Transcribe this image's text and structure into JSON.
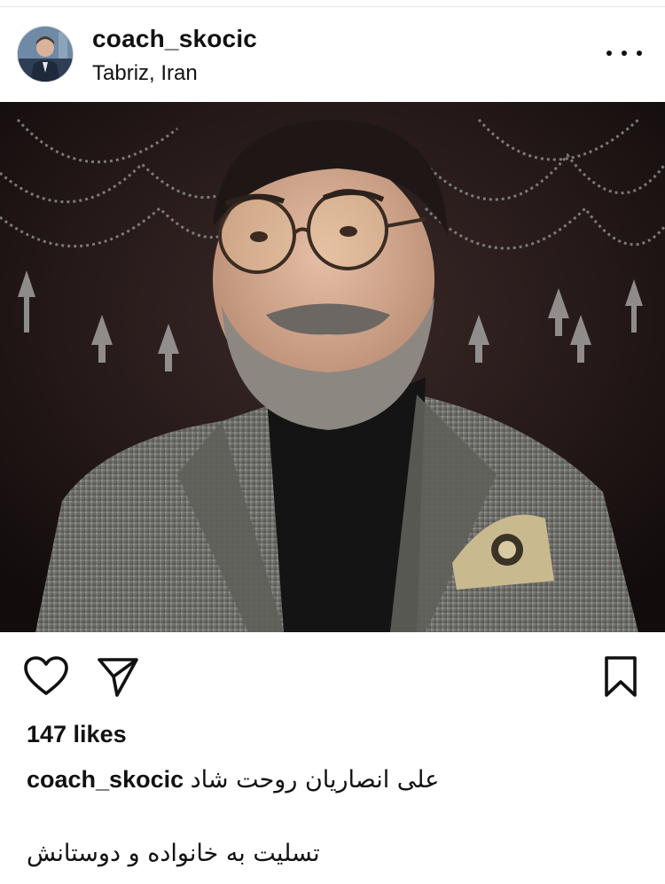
{
  "post": {
    "username": "coach_skocic",
    "location": "Tabriz, Iran",
    "likes": "147 likes",
    "caption_user": "coach_skocic",
    "caption_text": "علی انصاریان روحت شاد",
    "caption_extra": "تسلیت به خانواده و دوستانش"
  },
  "icons": {
    "more": "more-options-icon",
    "like": "heart-icon",
    "share": "paper-plane-icon",
    "save": "bookmark-icon"
  },
  "colors": {
    "text": "#111111",
    "background": "#ffffff",
    "divider": "#e6e6e6"
  }
}
